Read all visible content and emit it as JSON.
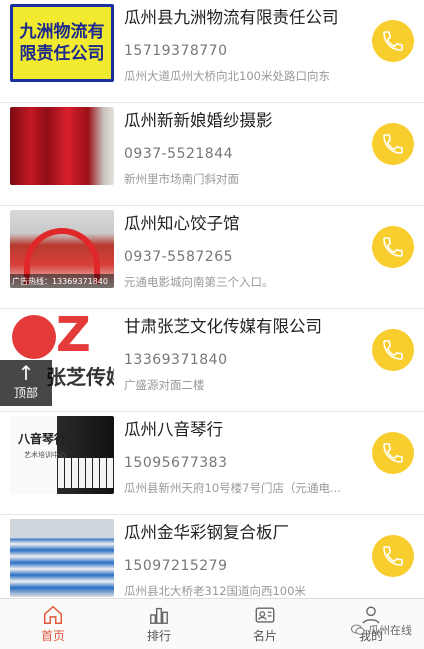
{
  "listings": [
    {
      "name": "瓜州县九洲物流有限责任公司",
      "phone": "15719378770",
      "address": "瓜州大道瓜州大桥向北100米处路口向东",
      "thumb_text": [
        "九洲物流有",
        "限责任公司"
      ]
    },
    {
      "name": "瓜州新新娘婚纱摄影",
      "phone": "0937-5521844",
      "address": "新州里市场南门斜对面"
    },
    {
      "name": "瓜州知心饺子馆",
      "phone": "0937-5587265",
      "address": "元通电影城向南第三个入口。",
      "thumb_text": [
        "广告热线：13369371840"
      ]
    },
    {
      "name": "甘肃张芝文化传媒有限公司",
      "phone": "13369371840",
      "address": "广盛源对面二楼",
      "thumb_text": [
        "Z",
        "张芝传媒"
      ]
    },
    {
      "name": "瓜州八音琴行",
      "phone": "15095677383",
      "address": "瓜州县新州天府10号楼7号门店（元通电...",
      "thumb_text": [
        "八音琴行",
        "艺术培训中心"
      ]
    },
    {
      "name": "瓜州金华彩钢复合板厂",
      "phone": "15097215279",
      "address": "瓜州县北大桥老312国道向西100米"
    }
  ],
  "back_to_top": {
    "label": "顶部"
  },
  "tabs": [
    {
      "label": "首页"
    },
    {
      "label": "排行"
    },
    {
      "label": "名片"
    },
    {
      "label": "我的"
    }
  ],
  "watermark": "瓜州在线",
  "colors": {
    "accent": "#f8cd2e",
    "active_tab": "#e05a3a"
  }
}
